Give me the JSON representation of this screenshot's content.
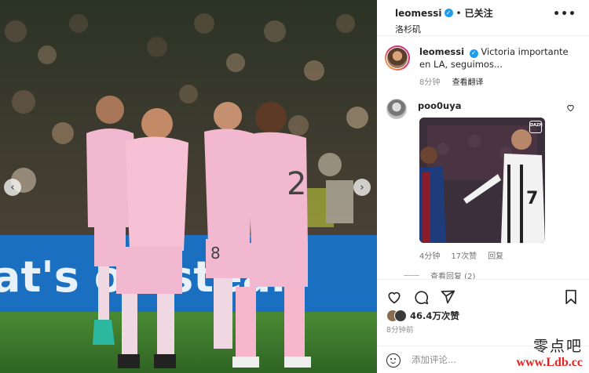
{
  "post": {
    "username": "leomessi",
    "follow_state": "已关注",
    "location": "洛杉矶",
    "more_label": "•••"
  },
  "caption": {
    "username": "leomessi",
    "text": "Victoria importante en LA, seguimos...",
    "time": "8分钟",
    "translate_label": "查看翻译"
  },
  "comments": [
    {
      "username": "poo0uya",
      "gif_badge": "DAZN",
      "time": "4分钟",
      "likes": "17次赞",
      "reply_label": "回复",
      "view_replies_label": "查看回复 (2)"
    }
  ],
  "photo": {
    "banner_text": "at's on  steal",
    "jersey_numbers": [
      "2",
      "8"
    ]
  },
  "actions": {
    "likes_count": "46.4万次赞",
    "time_ago": "8分钟前",
    "comment_placeholder": "添加评论..."
  },
  "watermark": {
    "site_name": "零点吧",
    "url": "www.Ldb.cc"
  },
  "colors": {
    "verified": "#1f9bf0",
    "jersey_pink": "#f2b8cf",
    "pitch_green": "#3f7a2e",
    "banner_blue": "#1b6fc0",
    "watermark_red": "#e52222"
  }
}
